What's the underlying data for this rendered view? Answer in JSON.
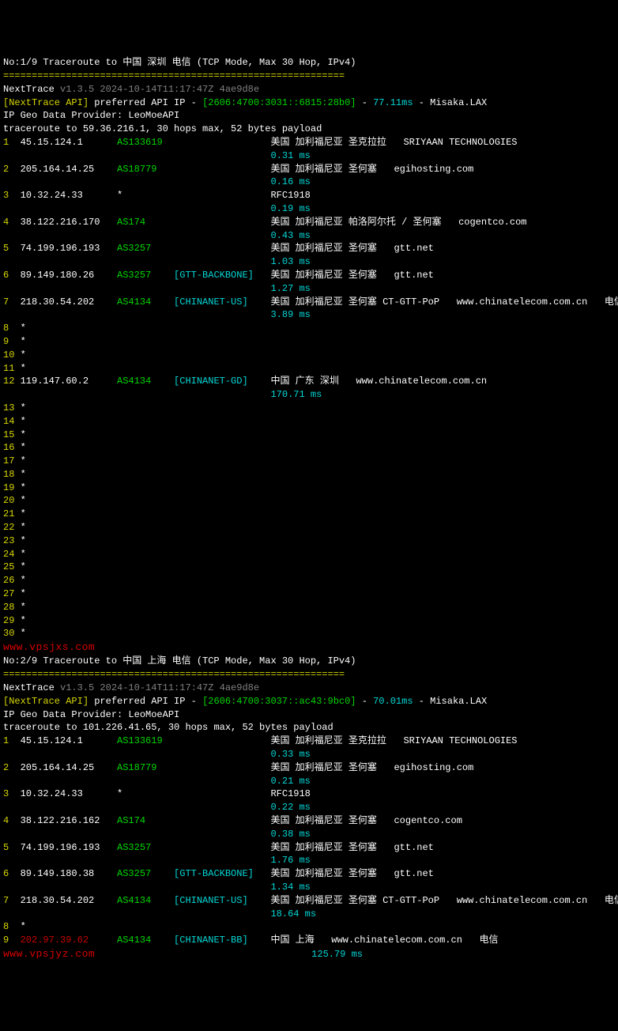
{
  "trace1": {
    "header": "No:1/9 Traceroute to 中国 深圳 电信 (TCP Mode, Max 30 Hop, IPv4)",
    "sep": "============================================================",
    "nextTrace": "NextTrace",
    "version": "v1.3.5 2024-10-14T11:17:47Z 4ae9d8e",
    "api_prefix": "[NextTrace API]",
    "api_mid": " preferred API IP - ",
    "api_ip": "[2606:4700:3031::6815:28b0]",
    "api_dash": " - ",
    "api_lat": "77.11ms",
    "api_end": " - Misaka.LAX",
    "geo": "IP Geo Data Provider: LeoMoeAPI",
    "target": "traceroute to 59.36.216.1, 30 hops max, 52 bytes payload",
    "hops": [
      {
        "n": "1",
        "ip": "45.15.124.1",
        "asn": "AS133619",
        "tag": "",
        "loc": "美国 加利福尼亚 圣克拉拉",
        "host": "SRIYAAN TECHNOLOGIES",
        "ms": "0.31 ms"
      },
      {
        "n": "2",
        "ip": "205.164.14.25",
        "asn": "AS18779",
        "tag": "",
        "loc": "美国 加利福尼亚 圣何塞",
        "host": "egihosting.com",
        "ms": "0.16 ms"
      },
      {
        "n": "3",
        "ip": "10.32.24.33",
        "asn": "*",
        "tag": "",
        "loc": "RFC1918",
        "host": "",
        "ms": "0.19 ms"
      },
      {
        "n": "4",
        "ip": "38.122.216.170",
        "asn": "AS174",
        "tag": "",
        "loc": "美国 加利福尼亚 帕洛阿尔托 / 圣何塞",
        "host": "cogentco.com",
        "ms": "0.43 ms"
      },
      {
        "n": "5",
        "ip": "74.199.196.193",
        "asn": "AS3257",
        "tag": "",
        "loc": "美国 加利福尼亚 圣何塞",
        "host": "gtt.net",
        "ms": "1.03 ms"
      },
      {
        "n": "6",
        "ip": "89.149.180.26",
        "asn": "AS3257",
        "tag": "[GTT-BACKBONE]",
        "loc": "美国 加利福尼亚 圣何塞",
        "host": "gtt.net",
        "ms": "1.27 ms"
      },
      {
        "n": "7",
        "ip": "218.30.54.202",
        "asn": "AS4134",
        "tag": "[CHINANET-US]",
        "loc": "美国 加利福尼亚 圣何塞 CT-GTT-PoP",
        "host": "www.chinatelecom.com.cn   电信",
        "ms": "3.89 ms"
      }
    ],
    "stars1": [
      "8",
      "9",
      "10",
      "11"
    ],
    "hop12": {
      "n": "12",
      "ip": "119.147.60.2",
      "asn": "AS4134",
      "tag": "[CHINANET-GD]",
      "loc": "中国 广东 深圳",
      "host": "www.chinatelecom.com.cn",
      "ms": "170.71 ms"
    },
    "stars2": [
      "13",
      "14",
      "15",
      "16",
      "17",
      "18",
      "19",
      "20",
      "21",
      "22",
      "23",
      "24",
      "25",
      "26",
      "27",
      "28",
      "29",
      "30"
    ],
    "watermark": "www.vpsjxs.com"
  },
  "trace2": {
    "header": "No:2/9 Traceroute to 中国 上海 电信 (TCP Mode, Max 30 Hop, IPv4)",
    "sep": "============================================================",
    "nextTrace": "NextTrace",
    "version": "v1.3.5 2024-10-14T11:17:47Z 4ae9d8e",
    "api_prefix": "[NextTrace API]",
    "api_mid": " preferred API IP - ",
    "api_ip": "[2606:4700:3037::ac43:9bc0]",
    "api_dash": " - ",
    "api_lat": "70.01ms",
    "api_end": " - Misaka.LAX",
    "geo": "IP Geo Data Provider: LeoMoeAPI",
    "target": "traceroute to 101.226.41.65, 30 hops max, 52 bytes payload",
    "hops": [
      {
        "n": "1",
        "ip": "45.15.124.1",
        "asn": "AS133619",
        "tag": "",
        "loc": "美国 加利福尼亚 圣克拉拉",
        "host": "SRIYAAN TECHNOLOGIES",
        "ms": "0.33 ms"
      },
      {
        "n": "2",
        "ip": "205.164.14.25",
        "asn": "AS18779",
        "tag": "",
        "loc": "美国 加利福尼亚 圣何塞",
        "host": "egihosting.com",
        "ms": "0.21 ms"
      },
      {
        "n": "3",
        "ip": "10.32.24.33",
        "asn": "*",
        "tag": "",
        "loc": "RFC1918",
        "host": "",
        "ms": "0.22 ms"
      },
      {
        "n": "4",
        "ip": "38.122.216.162",
        "asn": "AS174",
        "tag": "",
        "loc": "美国 加利福尼亚 圣何塞",
        "host": "cogentco.com",
        "ms": "0.38 ms"
      },
      {
        "n": "5",
        "ip": "74.199.196.193",
        "asn": "AS3257",
        "tag": "",
        "loc": "美国 加利福尼亚 圣何塞",
        "host": "gtt.net",
        "ms": "1.76 ms"
      },
      {
        "n": "6",
        "ip": "89.149.180.38",
        "asn": "AS3257",
        "tag": "[GTT-BACKBONE]",
        "loc": "美国 加利福尼亚 圣何塞",
        "host": "gtt.net",
        "ms": "1.34 ms"
      },
      {
        "n": "7",
        "ip": "218.30.54.202",
        "asn": "AS4134",
        "tag": "[CHINANET-US]",
        "loc": "美国 加利福尼亚 圣何塞 CT-GTT-PoP",
        "host": "www.chinatelecom.com.cn   电信",
        "ms": "18.64 ms"
      }
    ],
    "stars1": [
      "8"
    ],
    "hop9": {
      "n": "9",
      "ip": "202.97.39.62",
      "asn": "AS4134",
      "tag": "[CHINANET-BB]",
      "loc": "中国 上海",
      "host": "www.chinatelecom.com.cn   电信",
      "ms": "125.79 ms"
    },
    "watermark": "www.vpsjyz.com"
  },
  "cols": {
    "n": 3,
    "ip": 17,
    "asn": 10,
    "tag": 17,
    "loc": 48
  }
}
